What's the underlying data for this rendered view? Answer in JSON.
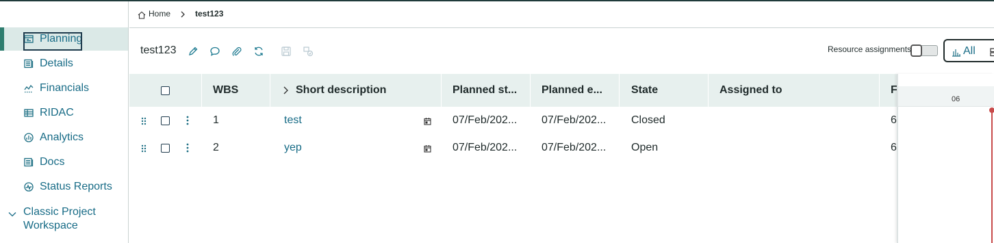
{
  "sidebar": {
    "items": [
      {
        "label": "Planning",
        "icon": "planning-icon"
      },
      {
        "label": "Details",
        "icon": "details-icon"
      },
      {
        "label": "Financials",
        "icon": "financials-icon"
      },
      {
        "label": "RIDAC",
        "icon": "ridac-icon"
      },
      {
        "label": "Analytics",
        "icon": "analytics-icon"
      },
      {
        "label": "Docs",
        "icon": "docs-icon"
      },
      {
        "label": "Status Reports",
        "icon": "status-reports-icon"
      }
    ],
    "classic_label": "Classic Project Workspace"
  },
  "breadcrumb": {
    "home": "Home",
    "current": "test123"
  },
  "toolbar": {
    "title": "test123",
    "resource_assignments_label": "Resource assignments",
    "view_all_label": "All"
  },
  "grid": {
    "headers": {
      "wbs": "WBS",
      "short_description": "Short description",
      "planned_start": "Planned st...",
      "planned_end": "Planned e...",
      "state": "State",
      "assigned_to": "Assigned to",
      "next": "F"
    },
    "rows": [
      {
        "wbs": "1",
        "description": "test",
        "planned_start": "07/Feb/202...",
        "planned_end": "07/Feb/202...",
        "state": "Closed",
        "assigned_to": "",
        "next": "6"
      },
      {
        "wbs": "2",
        "description": "yep",
        "planned_start": "07/Feb/202...",
        "planned_end": "07/Feb/202...",
        "state": "Open",
        "assigned_to": "",
        "next": "6"
      }
    ]
  },
  "gantt": {
    "day_label": "06"
  },
  "colors": {
    "accent": "#176b86",
    "active_bg": "#dbe9e7",
    "header_bg": "#e7f0ee",
    "today_line": "#c84a4a"
  }
}
